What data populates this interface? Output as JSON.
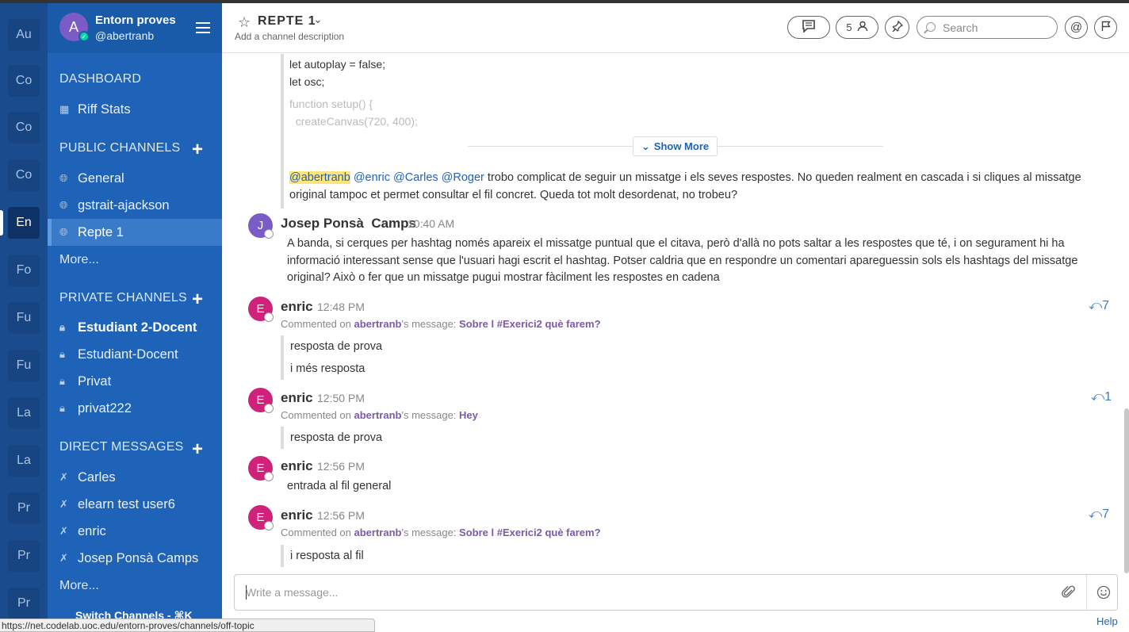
{
  "teams": [
    "Au",
    "Co",
    "Co",
    "Co",
    "En",
    "Fo",
    "Fu",
    "Fu",
    "La",
    "La",
    "Pr",
    "Pr",
    "Pr"
  ],
  "active_team_index": 4,
  "header": {
    "team_name": "Entorn proves",
    "username": "@abertranb",
    "avatar_letter": "A"
  },
  "sidebar": {
    "dashboard_title": "DASHBOARD",
    "dashboard_item": "Riff Stats",
    "public_title": "PUBLIC CHANNELS",
    "public_channels": [
      "General",
      "gstrait-ajackson",
      "Repte 1"
    ],
    "public_more": "More...",
    "private_title": "PRIVATE CHANNELS",
    "private_channels": [
      "Estudiant 2-Docent",
      "Estudiant-Docent",
      "Privat",
      "privat222"
    ],
    "dm_title": "DIRECT MESSAGES",
    "direct_messages": [
      "Carles",
      "elearn test user6",
      "enric",
      "Josep Ponsà  Camps"
    ],
    "dm_more": "More...",
    "switch_channels": "Switch Channels - ⌘K"
  },
  "channel": {
    "title": "REPTE 1",
    "description": "Add a channel description",
    "member_count": "5",
    "search_placeholder": "Search"
  },
  "code_snippet": [
    "let autoplay = false;",
    "let osc;",
    "function setup() {",
    "  createCanvas(720, 400);"
  ],
  "show_more": "Show More",
  "post_top": {
    "mentions": [
      "@abertranb",
      "@enric",
      "@Carles",
      "@Roger"
    ],
    "text": " trobo complicat de seguir un missatge i els seves respostes. No queden realment en cascada i si cliques al missatge original tampoc et permet consultar el fil concret. Queda tot molt desordenat, no trobeu?"
  },
  "messages": [
    {
      "avatar": "J",
      "color": "#7b5cc6",
      "user": "Josep Ponsà  Camps",
      "time": "10:40 AM",
      "text": "A banda, si cerques per hashtag només apareix el missatge puntual que el citava, però d'allà no pots saltar a les respostes que té, i on segurament hi ha informació interessant sense que l'usuari hagi escrit el hashtag. Potser caldria que en respondre un comentari apareguessin sols els hashtags del missatge original? Això o fer que un missatge pugui mostrar fàcilment les respostes en cadena"
    },
    {
      "avatar": "E",
      "color": "#d0217b",
      "user": "enric",
      "time": "12:48 PM",
      "replies": "7",
      "commented_prefix": "Commented on ",
      "commented_user": "abertranb",
      "commented_mid": "'s message: ",
      "commented_link": "Sobre l #Exerici2 què farem?",
      "lines": [
        "resposta de prova",
        "i més resposta"
      ]
    },
    {
      "avatar": "E",
      "color": "#d0217b",
      "user": "enric",
      "time": "12:50 PM",
      "replies": "1",
      "commented_prefix": "Commented on ",
      "commented_user": "abertranb",
      "commented_mid": "'s message: ",
      "commented_link": "Hey",
      "lines": [
        "resposta de prova"
      ]
    },
    {
      "avatar": "E",
      "color": "#d0217b",
      "user": "enric",
      "time": "12:56 PM",
      "text": "entrada al fil general"
    },
    {
      "avatar": "E",
      "color": "#d0217b",
      "user": "enric",
      "time": "12:56 PM",
      "replies": "7",
      "commented_prefix": "Commented on ",
      "commented_user": "abertranb",
      "commented_mid": "'s message: ",
      "commented_link": "Sobre l #Exerici2 què farem?",
      "lines": [
        "i resposta al fil"
      ]
    }
  ],
  "input": {
    "placeholder": "Write a message..."
  },
  "help": "Help",
  "status_url": "https://net.codelab.uoc.edu/entorn-proves/channels/off-topic"
}
